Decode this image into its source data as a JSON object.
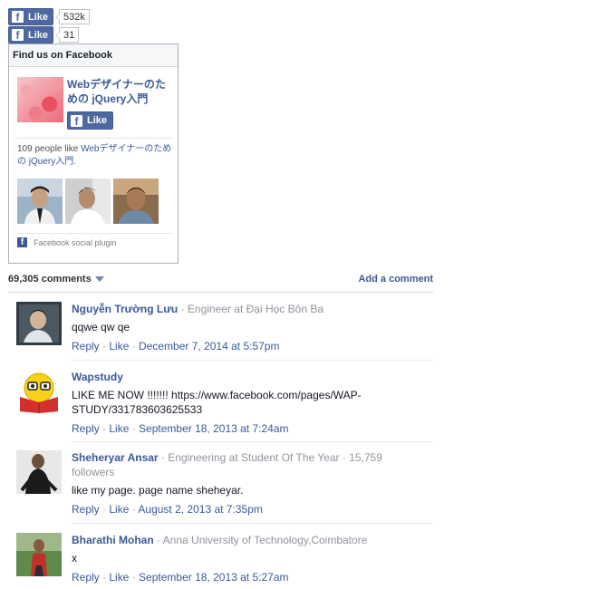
{
  "like_buttons": [
    {
      "label": "Like",
      "count": "532k"
    },
    {
      "label": "Like",
      "count": "31"
    }
  ],
  "fb_box": {
    "title": "Find us on Facebook",
    "page_name": "Webデザイナーのための jQuery入門",
    "like_label": "Like",
    "people_text_count": "109 people like ",
    "people_text_page": "Webデザイナーのための jQuery入門.",
    "plugin_label": "Facebook social plugin"
  },
  "comments_bar": {
    "count_label": "69,305 comments",
    "add_label": "Add a comment"
  },
  "comments": [
    {
      "name": "Nguyễn Trường Lưu",
      "meta": " · Engineer at Đại Học Bôn Ba",
      "text": "qqwe qw qe",
      "reply": "Reply",
      "like": "Like",
      "date": "December 7, 2014 at 5:57pm"
    },
    {
      "name": "Wapstudy",
      "meta": "",
      "text": "LIKE ME NOW !!!!!!! https://www.facebook.com/pages/WAP-STUDY/331783603625533",
      "reply": "Reply",
      "like": "Like",
      "date": "September 18, 2013 at 7:24am"
    },
    {
      "name": "Sheheryar Ansar",
      "meta": " · Engineering at Student Of The Year · 15,759 followers",
      "text": "like my page. page name sheheyar.",
      "reply": "Reply",
      "like": "Like",
      "date": "August 2, 2013 at 7:35pm"
    },
    {
      "name": "Bharathi Mohan",
      "meta": " · Anna University of Technology,Coimbatore",
      "text": "x",
      "reply": "Reply",
      "like": "Like",
      "date": "September 18, 2013 at 5:27am"
    }
  ],
  "colors": {
    "facebook_blue": "#3b5998",
    "button_blue": "#4e69a2",
    "meta_gray": "#90949c"
  }
}
